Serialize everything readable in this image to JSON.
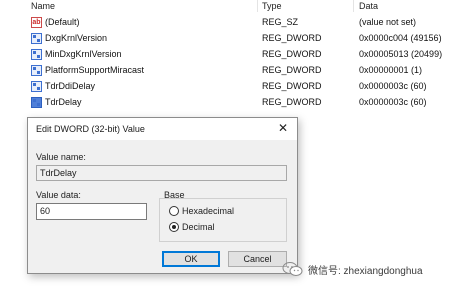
{
  "columns": {
    "name": "Name",
    "type": "Type",
    "data": "Data"
  },
  "rows": [
    {
      "icon": "string-value-icon",
      "name": "(Default)",
      "type": "REG_SZ",
      "data": "(value not set)"
    },
    {
      "icon": "dword-value-icon",
      "name": "DxgKrnlVersion",
      "type": "REG_DWORD",
      "data": "0x0000c004 (49156)"
    },
    {
      "icon": "dword-value-icon",
      "name": "MinDxgKrnlVersion",
      "type": "REG_DWORD",
      "data": "0x00005013 (20499)"
    },
    {
      "icon": "dword-value-icon",
      "name": "PlatformSupportMiracast",
      "type": "REG_DWORD",
      "data": "0x00000001 (1)"
    },
    {
      "icon": "dword-value-icon",
      "name": "TdrDdiDelay",
      "type": "REG_DWORD",
      "data": "0x0000003c (60)"
    },
    {
      "icon": "dword-value-icon",
      "name": "TdrDelay",
      "type": "REG_DWORD",
      "data": "0x0000003c (60)"
    }
  ],
  "dialog": {
    "title": "Edit DWORD (32-bit) Value",
    "close_glyph": "✕",
    "value_name_label": "Value name:",
    "value_name": "TdrDelay",
    "value_data_label": "Value data:",
    "value_data": "60",
    "base_label": "Base",
    "base_options": [
      "Hexadecimal",
      "Decimal"
    ],
    "base_selected": "Decimal",
    "ok_label": "OK",
    "cancel_label": "Cancel"
  },
  "watermark": {
    "text": "微信号: zhexiangdonghua",
    "icon": "wechat-icon"
  }
}
